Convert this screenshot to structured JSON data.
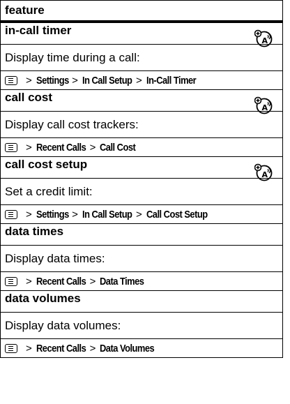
{
  "table": {
    "header": "feature",
    "sections": [
      {
        "title": "in-call timer",
        "has_network_icon": true,
        "description": "Display time during a call:",
        "path": [
          "Settings",
          "In Call Setup",
          "In-Call Timer"
        ]
      },
      {
        "title": "call cost",
        "has_network_icon": true,
        "description": "Display call cost trackers:",
        "path": [
          "Recent Calls",
          "Call Cost"
        ]
      },
      {
        "title": "call cost setup",
        "has_network_icon": true,
        "description": "Set a credit limit:",
        "path": [
          "Settings",
          "In Call Setup",
          "Call Cost Setup"
        ]
      },
      {
        "title": "data times",
        "has_network_icon": false,
        "description": "Display data times:",
        "path": [
          "Recent Calls",
          "Data Times"
        ]
      },
      {
        "title": "data volumes",
        "has_network_icon": false,
        "description": "Display data volumes:",
        "path": [
          "Recent Calls",
          "Data Volumes"
        ]
      }
    ],
    "separator": ">",
    "icons": {
      "menu_key": "menu-key-icon",
      "network": "network-dependent-feature-icon"
    }
  }
}
